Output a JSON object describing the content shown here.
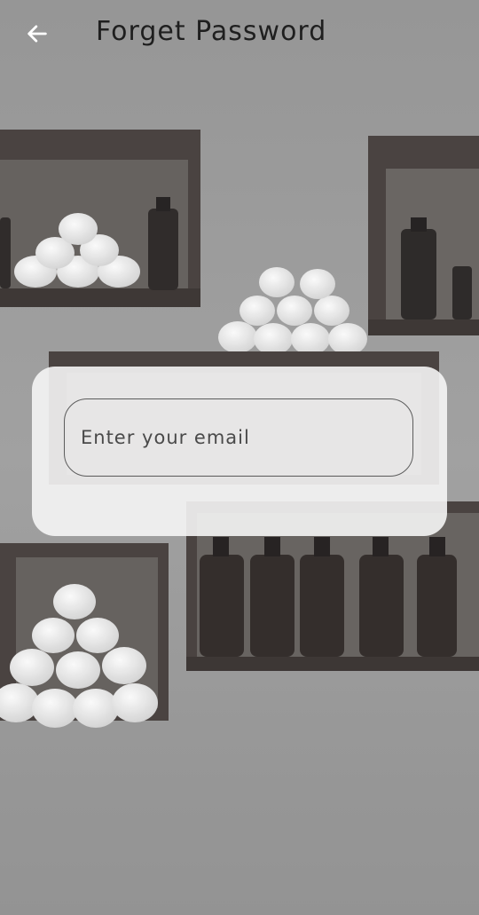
{
  "header": {
    "title": "Forget Password",
    "back_icon": "arrow-left-icon"
  },
  "form": {
    "email_placeholder": "Enter your email"
  },
  "colors": {
    "wall": "#8f8f8f",
    "card": "#f5f5f5",
    "title_text": "#1f1f1f",
    "field_border": "#5c5c5c"
  }
}
